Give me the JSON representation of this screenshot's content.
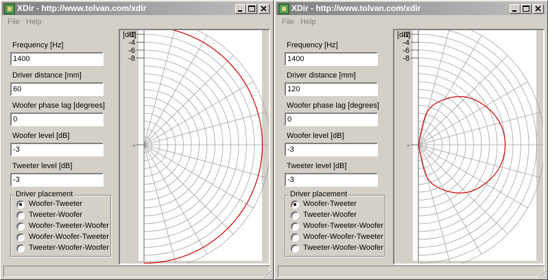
{
  "windows": [
    {
      "title": "XDir - http://www.tolvan.com/xdir",
      "menu": [
        "File",
        "Help"
      ],
      "fields": [
        {
          "label": "Frequency [Hz]",
          "value": "1400"
        },
        {
          "label": "Driver distance [mm]",
          "value": "60"
        },
        {
          "label": "Woofer phase lag [degrees]",
          "value": "0"
        },
        {
          "label": "Woofer level [dB]",
          "value": "-3"
        },
        {
          "label": "Tweeter level [dB]",
          "value": "-3"
        }
      ],
      "placement": {
        "legend": "Driver placement",
        "options": [
          "Woofer-Tweeter",
          "Tweeter-Woofer",
          "Woofer-Tweeter-Woofer",
          "Woofer-Woofer-Tweeter",
          "Tweeter-Woofer-Woofer"
        ],
        "selected_index": 0
      },
      "chart_data": {
        "type": "polar",
        "title": "",
        "unit_label": "[dB]",
        "radial_ticks": [
          "2",
          "0",
          "-2",
          "-4",
          "-6",
          "-8",
          "-"
        ],
        "angles_deg": [
          -90,
          -60,
          -30,
          0,
          30,
          60,
          90
        ],
        "response_db": [
          0,
          0,
          0,
          0,
          0,
          0,
          0
        ],
        "line_color": "#cc0000"
      }
    },
    {
      "title": "XDir - http://www.tolvan.com/xdir",
      "menu": [
        "File",
        "Help"
      ],
      "fields": [
        {
          "label": "Frequency [Hz]",
          "value": "1400"
        },
        {
          "label": "Driver distance [mm]",
          "value": "120"
        },
        {
          "label": "Woofer phase lag [degrees]",
          "value": "0"
        },
        {
          "label": "Woofer level [dB]",
          "value": "-3"
        },
        {
          "label": "Tweeter level [dB]",
          "value": "-3"
        }
      ],
      "placement": {
        "legend": "Driver placement",
        "options": [
          "Woofer-Tweeter",
          "Tweeter-Woofer",
          "Woofer-Tweeter-Woofer",
          "Woofer-Woofer-Tweeter",
          "Tweeter-Woofer-Woofer"
        ],
        "selected_index": 0
      },
      "chart_data": {
        "type": "polar",
        "title": "",
        "unit_label": "[dB]",
        "radial_ticks": [
          "2",
          "0",
          "-2",
          "-4",
          "-6",
          "-8",
          "-"
        ],
        "angles_deg": [
          -90,
          -75,
          -60,
          -45,
          -30,
          -15,
          0,
          15,
          30,
          45,
          60,
          75,
          90
        ],
        "response_db": [
          -30,
          -21.4,
          -16.7,
          -12.9,
          -10.4,
          -8.6,
          -8,
          -8.6,
          -10.4,
          -12.9,
          -16.7,
          -21.4,
          -30
        ],
        "line_color": "#cc0000"
      }
    }
  ]
}
